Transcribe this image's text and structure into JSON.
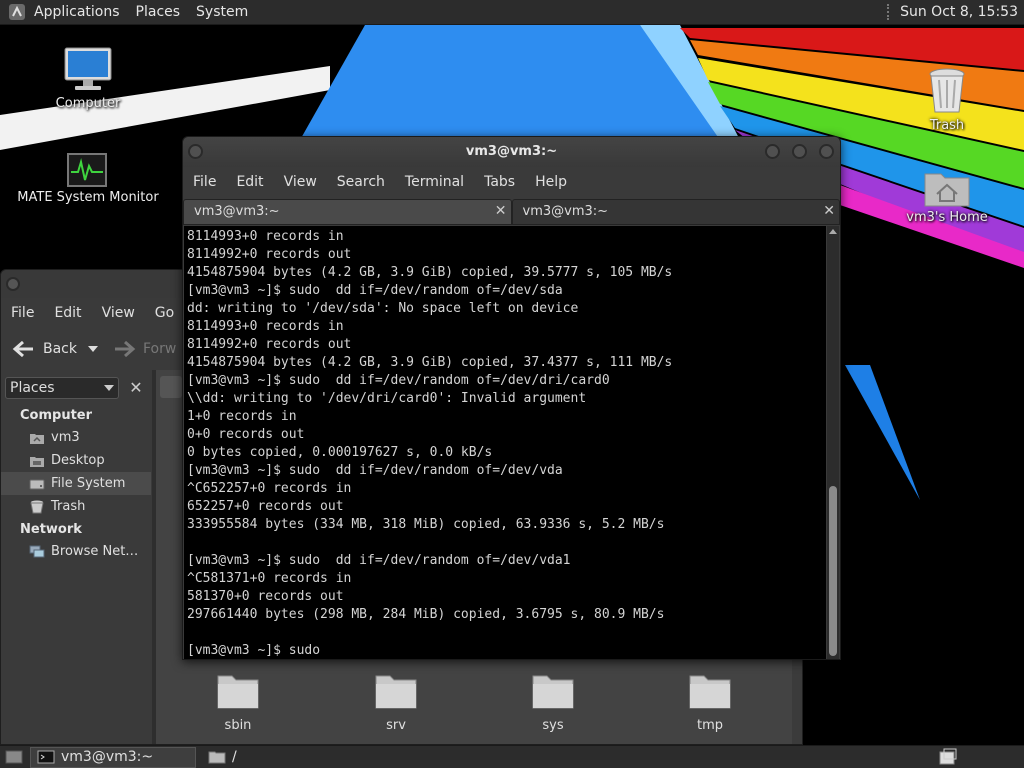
{
  "top_panel": {
    "menus": [
      "Applications",
      "Places",
      "System"
    ],
    "clock": "Sun Oct  8, 15:53"
  },
  "desktop_icons": {
    "computer": "Computer",
    "system_monitor": "MATE System Monitor",
    "trash": "Trash",
    "home": "vm3's Home"
  },
  "file_manager": {
    "menus": [
      "File",
      "Edit",
      "View",
      "Go"
    ],
    "toolbar": {
      "back": "Back",
      "forward": "Forw"
    },
    "places_select": "Places",
    "sidebar": {
      "computer_heading": "Computer",
      "computer_items": [
        "vm3",
        "Desktop",
        "File System",
        "Trash"
      ],
      "network_heading": "Network",
      "network_items": [
        "Browse Net…"
      ]
    },
    "folders": [
      "sbin",
      "srv",
      "sys",
      "tmp"
    ]
  },
  "terminal": {
    "title": "vm3@vm3:~",
    "menus": [
      "File",
      "Edit",
      "View",
      "Search",
      "Terminal",
      "Tabs",
      "Help"
    ],
    "tabs": [
      "vm3@vm3:~",
      "vm3@vm3:~"
    ],
    "lines": [
      "8114993+0 records in",
      "8114992+0 records out",
      "4154875904 bytes (4.2 GB, 3.9 GiB) copied, 39.5777 s, 105 MB/s",
      "[vm3@vm3 ~]$ sudo  dd if=/dev/random of=/dev/sda",
      "dd: writing to '/dev/sda': No space left on device",
      "8114993+0 records in",
      "8114992+0 records out",
      "4154875904 bytes (4.2 GB, 3.9 GiB) copied, 37.4377 s, 111 MB/s",
      "[vm3@vm3 ~]$ sudo  dd if=/dev/random of=/dev/dri/card0",
      "\\\\dd: writing to '/dev/dri/card0': Invalid argument",
      "1+0 records in",
      "0+0 records out",
      "0 bytes copied, 0.000197627 s, 0.0 kB/s",
      "[vm3@vm3 ~]$ sudo  dd if=/dev/random of=/dev/vda",
      "^C652257+0 records in",
      "652257+0 records out",
      "333955584 bytes (334 MB, 318 MiB) copied, 63.9336 s, 5.2 MB/s",
      "",
      "[vm3@vm3 ~]$ sudo  dd if=/dev/random of=/dev/vda1",
      "^C581371+0 records in",
      "581370+0 records out",
      "297661440 bytes (298 MB, 284 MiB) copied, 3.6795 s, 80.9 MB/s",
      "",
      "[vm3@vm3 ~]$ sudo"
    ]
  },
  "bottom_panel": {
    "tasks": [
      "vm3@vm3:~",
      "/"
    ]
  },
  "colors": {
    "panel": "#2c2c2c",
    "terminal_bg": "#000000",
    "wallpaper_blue": "#1e8ff0"
  }
}
